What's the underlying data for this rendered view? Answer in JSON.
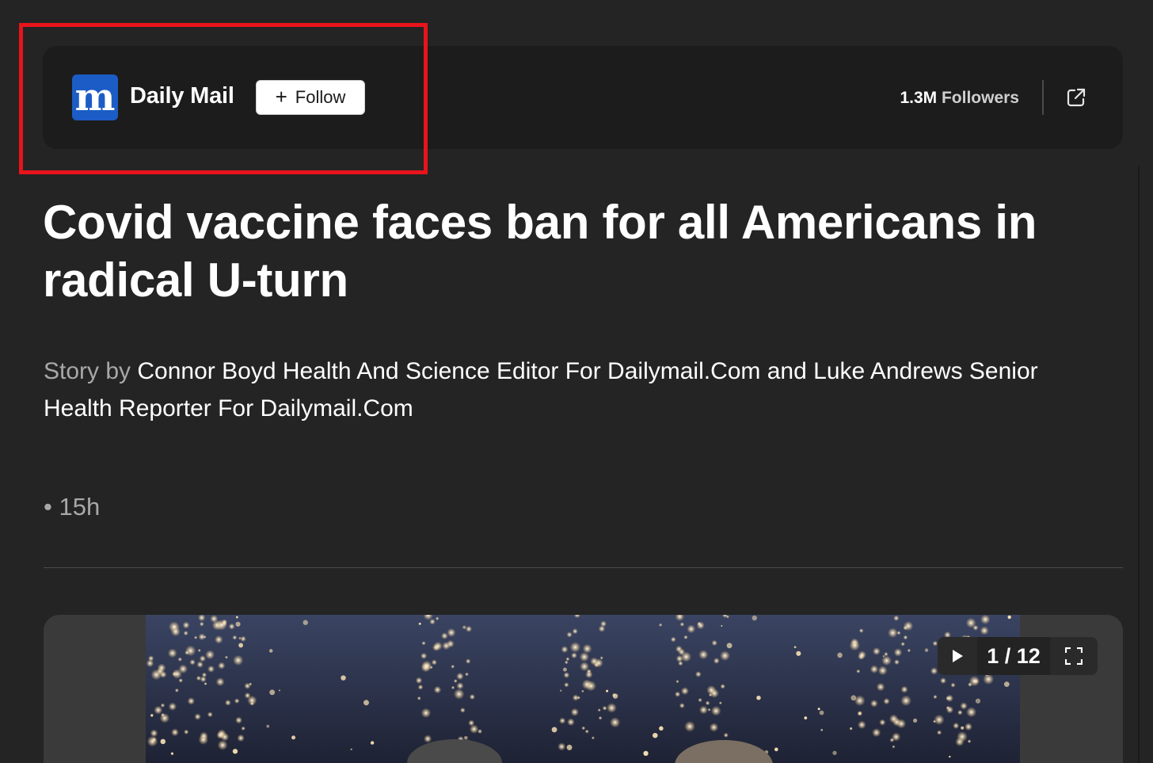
{
  "publisher": {
    "logo_letter": "m",
    "name": "Daily Mail",
    "follow_label": "Follow",
    "followers_count": "1.3M",
    "followers_label": "Followers"
  },
  "article": {
    "headline": "Covid vaccine faces ban for all Americans in radical U-turn",
    "story_by_label": "Story by",
    "authors": "Connor Boyd Health And Science Editor For Dailymail.Com and Luke Andrews Senior Health Reporter For Dailymail.Com",
    "timestamp": "• 15h"
  },
  "gallery": {
    "counter": "1 / 12"
  },
  "colors": {
    "background": "#242424",
    "publisher_bar": "#1c1c1c",
    "logo_blue": "#1c5cc6",
    "highlight_red": "#e8141b"
  }
}
